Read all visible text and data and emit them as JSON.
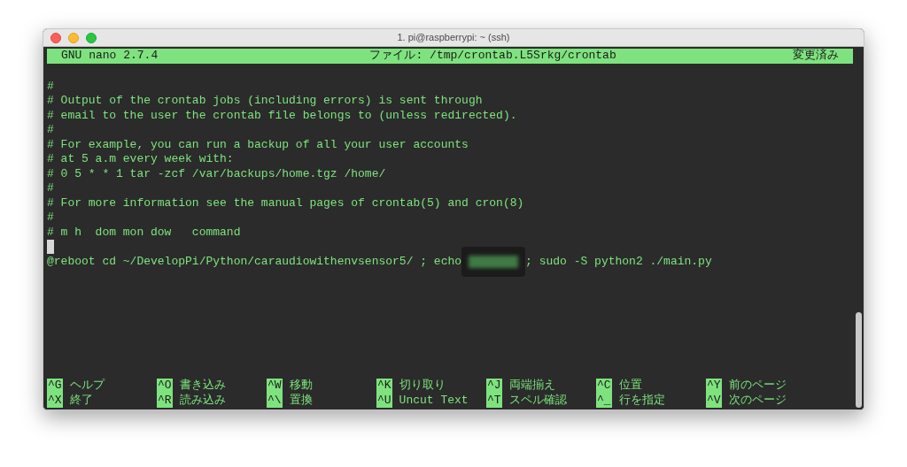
{
  "window": {
    "title": "1. pi@raspberrypi: ~ (ssh)"
  },
  "header": {
    "version": "GNU nano 2.7.4",
    "file": "ファイル: /tmp/crontab.L5Srkg/crontab",
    "status": "変更済み"
  },
  "lines": [
    {
      "text": "#"
    },
    {
      "text": "# Output of the crontab jobs (including errors) is sent through"
    },
    {
      "text": "# email to the user the crontab file belongs to (unless redirected)."
    },
    {
      "text": "#"
    },
    {
      "text": "# For example, you can run a backup of all your user accounts"
    },
    {
      "text": "# at 5 a.m every week with:"
    },
    {
      "text": "# 0 5 * * 1 tar -zcf /var/backups/home.tgz /home/"
    },
    {
      "text": "#"
    },
    {
      "text": "# For more information see the manual pages of crontab(5) and cron(8)"
    },
    {
      "text": "#"
    },
    {
      "text": "# m h  dom mon dow   command"
    },
    {
      "cursor": true
    },
    {
      "text": "@reboot cd ~/DevelopPi/Python/caraudiowithenvsensor5/ ; echo",
      "redacted": true,
      "after": "; sudo -S python2 ./main.py"
    }
  ],
  "shortcuts": [
    [
      {
        "key": "^G",
        "label": "ヘルプ"
      },
      {
        "key": "^X",
        "label": "終了"
      }
    ],
    [
      {
        "key": "^O",
        "label": "書き込み"
      },
      {
        "key": "^R",
        "label": "読み込み"
      }
    ],
    [
      {
        "key": "^W",
        "label": "移動"
      },
      {
        "key": "^\\",
        "label": "置換"
      }
    ],
    [
      {
        "key": "^K",
        "label": "切り取り"
      },
      {
        "key": "^U",
        "label": "Uncut Text"
      }
    ],
    [
      {
        "key": "^J",
        "label": "両端揃え"
      },
      {
        "key": "^T",
        "label": "スペル確認"
      }
    ],
    [
      {
        "key": "^C",
        "label": "位置"
      },
      {
        "key": "^_",
        "label": "行を指定"
      }
    ],
    [
      {
        "key": "^Y",
        "label": "前のページ"
      },
      {
        "key": "^V",
        "label": "次のページ"
      }
    ]
  ]
}
